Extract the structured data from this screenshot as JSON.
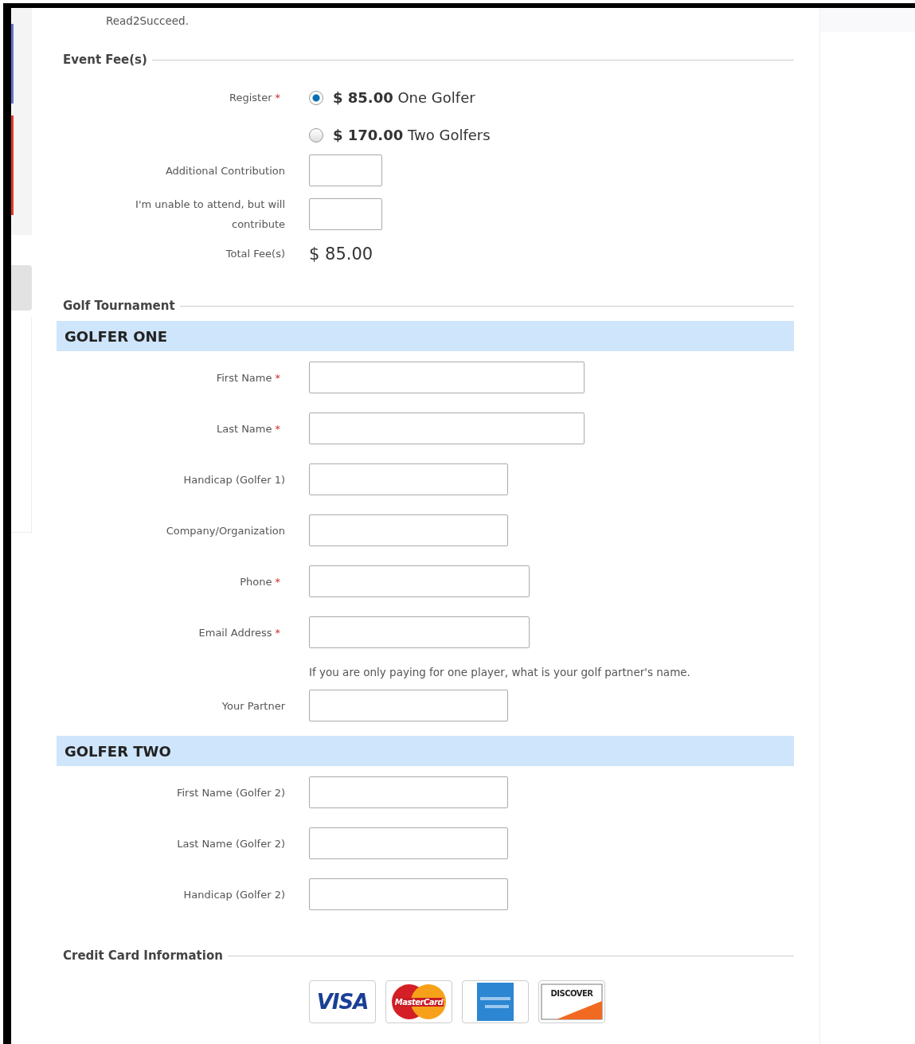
{
  "intro_tail": "Read2Succeed.",
  "event_fees": {
    "heading": "Event Fee(s)",
    "register_label": "Register",
    "register_required_mark": "*",
    "options": [
      {
        "text": "**$ 85.00** One Golfer",
        "selected": true
      },
      {
        "text": "**$ 170.00** Two Golfers",
        "selected": false
      }
    ],
    "fields": [
      {
        "label": "Additional Contribution"
      },
      {
        "label": "I'm unable to attend, but will contribute"
      }
    ],
    "total_label": "Total Fee(s)",
    "total_value": "$ 85.00"
  },
  "tournament": {
    "heading": "Golf Tournament",
    "sections": [
      {
        "title": "GOLFER ONE",
        "items": [
          {
            "kind": "wide",
            "label": "First Name",
            "required_mark": "*"
          },
          {
            "kind": "wide",
            "label": "Last Name",
            "required_mark": "*"
          },
          {
            "kind": "short",
            "label": "Handicap (Golfer 1)"
          },
          {
            "kind": "short",
            "label": "Company/Organization"
          },
          {
            "kind": "medium",
            "label": "Phone",
            "required_mark": "*"
          },
          {
            "kind": "medium",
            "label": "Email Address",
            "required_mark": "*"
          },
          {
            "kind": "hint",
            "text": "If you are only paying for one player, what is your golf partner's name."
          },
          {
            "kind": "short",
            "label": "Your Partner"
          }
        ]
      },
      {
        "title": "GOLFER TWO",
        "items": [
          {
            "kind": "short",
            "label": "First Name (Golfer 2)"
          },
          {
            "kind": "short",
            "label": "Last Name (Golfer 2)"
          },
          {
            "kind": "short",
            "label": "Handicap (Golfer 2)"
          }
        ]
      }
    ]
  },
  "credit_card": {
    "heading": "Credit Card Information",
    "cards": [
      {
        "kind": "visa",
        "label": "VISA"
      },
      {
        "kind": "mastercard",
        "label": "MasterCard"
      },
      {
        "kind": "amex"
      },
      {
        "kind": "discover",
        "label": "DISCOVER"
      }
    ]
  }
}
